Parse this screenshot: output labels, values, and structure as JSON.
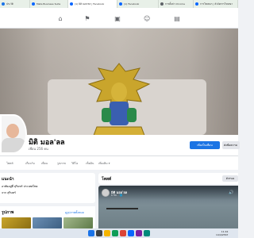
{
  "browser_tabs": [
    {
      "label": "ประวัติ",
      "color": "#1a73e8"
    },
    {
      "label": "Meta Business Suite",
      "color": "#0866ff"
    },
    {
      "label": "(1) มิติ มอล'ลล | Facebook",
      "color": "#0866ff"
    },
    {
      "label": "(1) Facebook",
      "color": "#0866ff"
    },
    {
      "label": "การตั้งค่า Chrome",
      "color": "#5f6368"
    },
    {
      "label": "การโฆษณา | ตัวจัดการโฆษณา",
      "color": "#0866ff"
    }
  ],
  "profile": {
    "name": "มิติ มอล'ลล",
    "friends": "เพื่อน 256 คน",
    "primary_button": "เพิ่มเป็นเพื่อน",
    "secondary_button": "ส่งข้อความ"
  },
  "profile_tabs": [
    "โพสต์",
    "เกี่ยวกับ",
    "เพื่อน",
    "รูปภาพ",
    "วิดีโอ",
    "เช็คอิน",
    "เพิ่มเติม ▾"
  ],
  "intro": {
    "title": "แนะนำ",
    "rows": [
      "อาศัยอยู่ที่ สุรินทร์ ประเทศไทย",
      "จาก สุรินทร์"
    ]
  },
  "photos": {
    "title": "รูปภาพ",
    "link": "ดูรูปภาพทั้งหมด"
  },
  "posts": {
    "title": "โพสต์",
    "filter": "ตัวกรอง"
  },
  "post": {
    "author": "มิติ มอล'ลล",
    "time": "6 ชม. · 🌐"
  },
  "taskbar": {
    "time": "11:42",
    "date": "14/4/2567"
  },
  "colors": {
    "primary": "#1b74e4",
    "background": "#f0f2f5"
  }
}
